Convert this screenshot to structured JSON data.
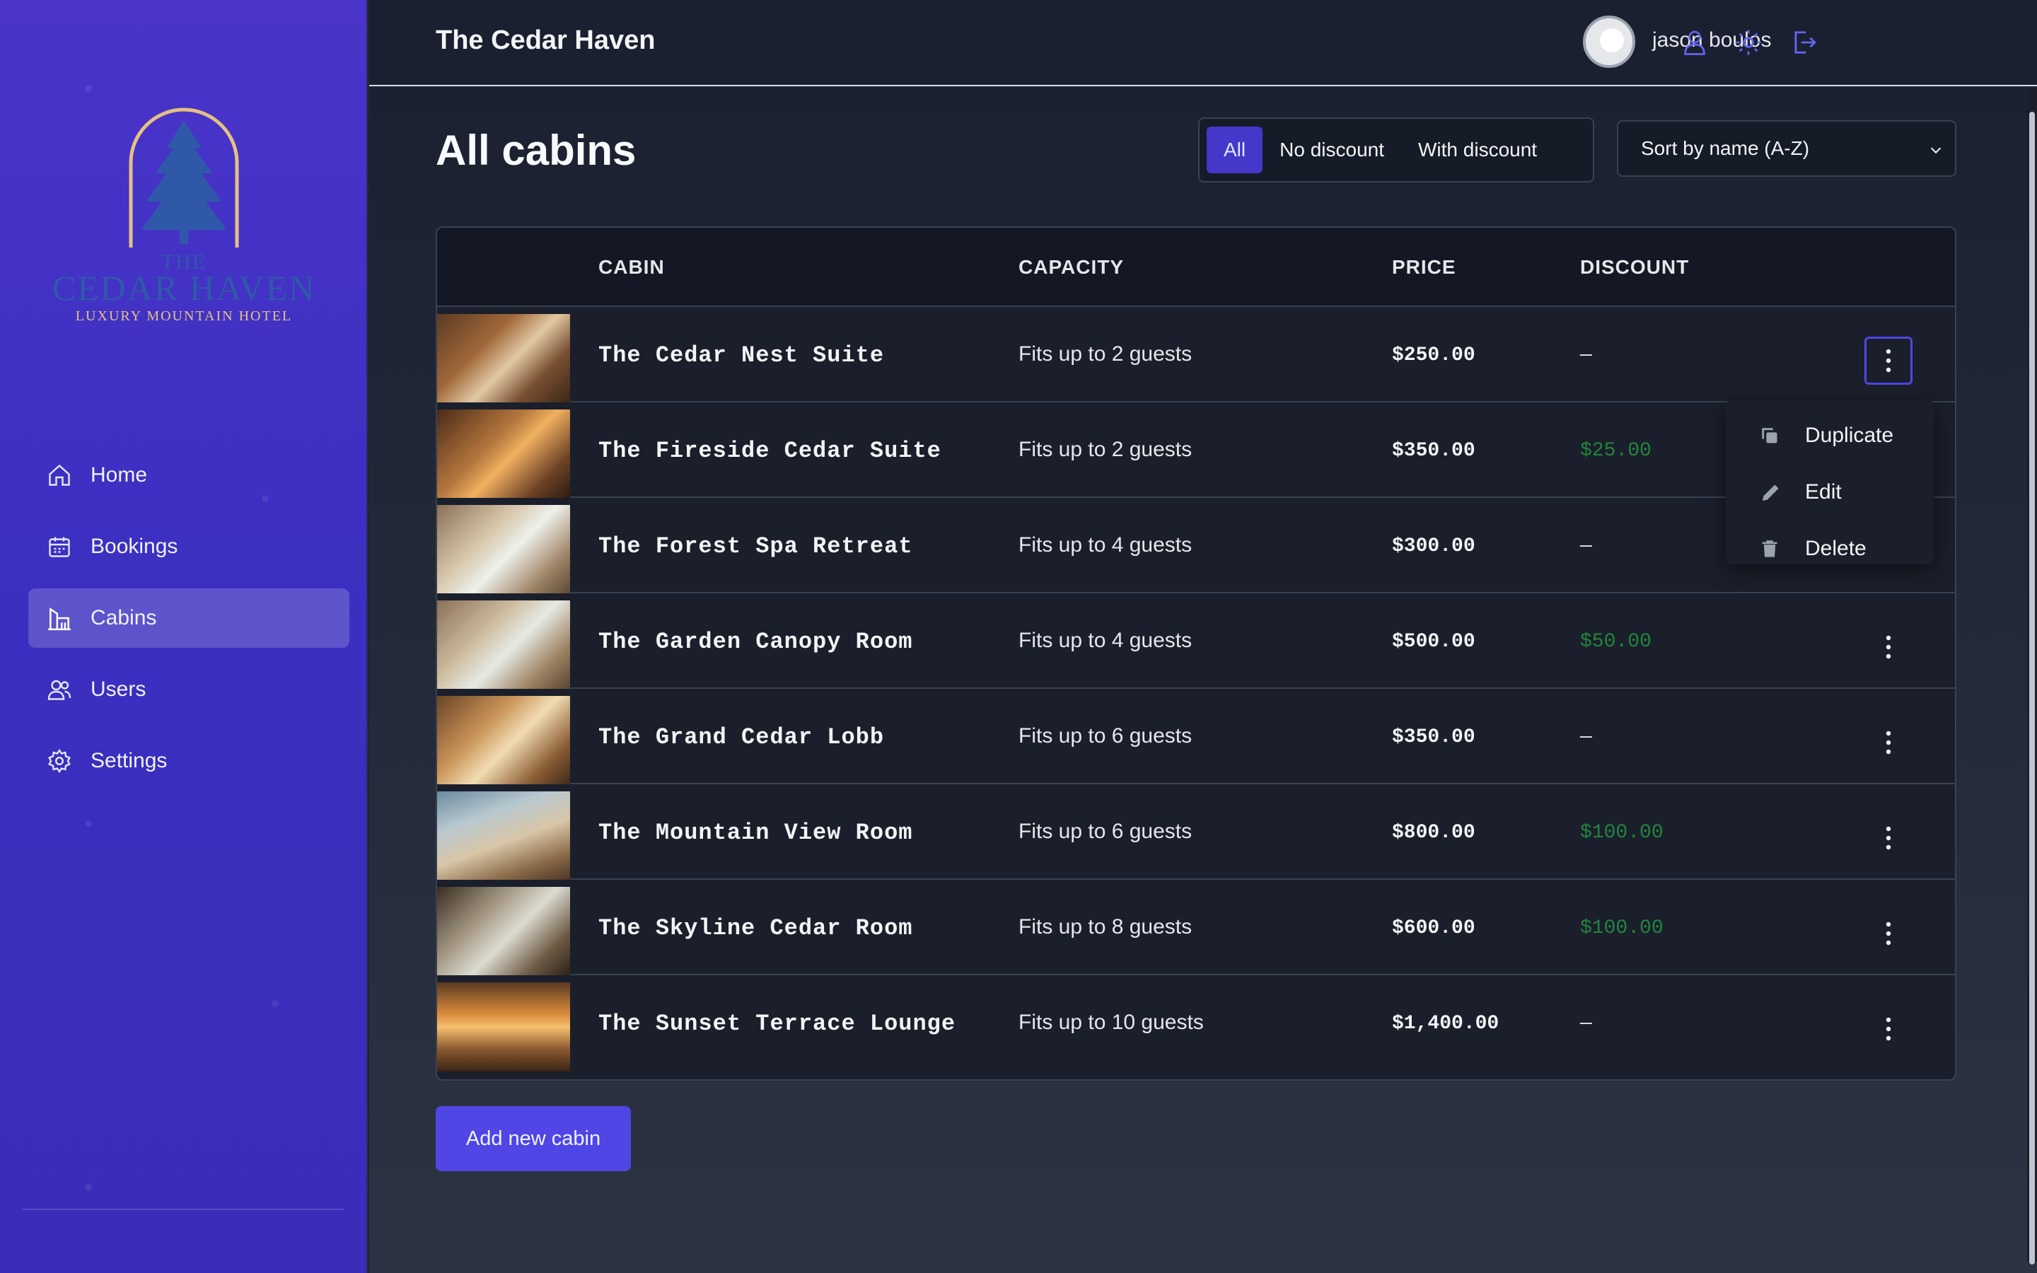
{
  "app": {
    "title": "The Cedar Haven"
  },
  "brand": {
    "logo_line1": "THE",
    "logo_line2": "CEDAR HAVEN",
    "tagline": "LUXURY MOUNTAIN HOTEL",
    "colors": {
      "gold": "#e4c184",
      "blue": "#2f59a8"
    }
  },
  "sidebar": {
    "items": [
      {
        "label": "Home",
        "icon": "home-icon",
        "active": false
      },
      {
        "label": "Bookings",
        "icon": "calendar-icon",
        "active": false
      },
      {
        "label": "Cabins",
        "icon": "cabin-icon",
        "active": true
      },
      {
        "label": "Users",
        "icon": "users-icon",
        "active": false
      },
      {
        "label": "Settings",
        "icon": "gear-icon",
        "active": false
      }
    ]
  },
  "header": {
    "username": "jason boulos",
    "icons": [
      "user-icon",
      "sun-icon",
      "logout-icon"
    ]
  },
  "page": {
    "title": "All cabins"
  },
  "filter": {
    "options": [
      "All",
      "No discount",
      "With discount"
    ],
    "selected": "All"
  },
  "sort": {
    "selected": "Sort by name (A-Z)"
  },
  "table": {
    "columns": [
      "CABIN",
      "CAPACITY",
      "PRICE",
      "DISCOUNT"
    ],
    "rows": [
      {
        "name": "The Cedar Nest Suite",
        "capacity": "Fits up to 2 guests",
        "price": "$250.00",
        "discount": "—"
      },
      {
        "name": "The Fireside Cedar Suite",
        "capacity": "Fits up to 2 guests",
        "price": "$350.00",
        "discount": "$25.00"
      },
      {
        "name": "The Forest Spa Retreat",
        "capacity": "Fits up to 4 guests",
        "price": "$300.00",
        "discount": "—"
      },
      {
        "name": "The Garden Canopy Room",
        "capacity": "Fits up to 4 guests",
        "price": "$500.00",
        "discount": "$50.00"
      },
      {
        "name": "The Grand Cedar Lobb",
        "capacity": "Fits up to 6 guests",
        "price": "$350.00",
        "discount": "—"
      },
      {
        "name": "The Mountain View Room",
        "capacity": "Fits up to 6 guests",
        "price": "$800.00",
        "discount": "$100.00"
      },
      {
        "name": "The Skyline Cedar Room",
        "capacity": "Fits up to 8 guests",
        "price": "$600.00",
        "discount": "$100.00"
      },
      {
        "name": "The Sunset Terrace Lounge",
        "capacity": "Fits up to 10 guests",
        "price": "$1,400.00",
        "discount": "—"
      }
    ]
  },
  "context_menu": {
    "items": [
      {
        "label": "Duplicate",
        "icon": "duplicate-icon"
      },
      {
        "label": "Edit",
        "icon": "pencil-icon"
      },
      {
        "label": "Delete",
        "icon": "trash-icon"
      }
    ]
  },
  "actions": {
    "add_cabin": "Add new cabin"
  },
  "colors": {
    "accent": "#4f46e5",
    "discount_green": "#22863a",
    "sidebar": "#4a34c9"
  }
}
